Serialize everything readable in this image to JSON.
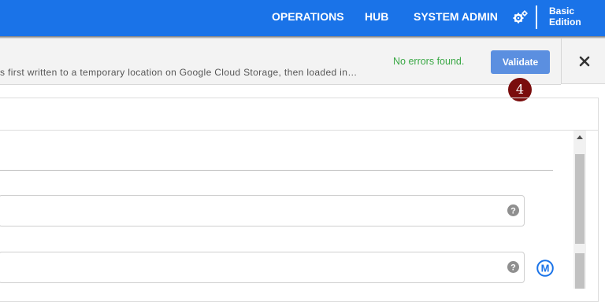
{
  "nav": {
    "items": [
      "OPERATIONS",
      "HUB",
      "SYSTEM ADMIN"
    ],
    "edition_line1": "Basic",
    "edition_line2": "Edition",
    "settings_icon": "gears-icon"
  },
  "validation": {
    "description": "s first written to a temporary location on Google Cloud Storage, then loaded in…",
    "status": "No errors found.",
    "validate_label": "Validate",
    "close_icon": "close-icon",
    "step_number": "4"
  },
  "colors": {
    "nav_bg": "#1a73e8",
    "success": "#3aa845",
    "button": "#5b8fe0",
    "badge": "#7a0d0d",
    "macro": "#1a73e8"
  },
  "fields": {
    "help_icon": "question-icon",
    "macro_label": "M"
  }
}
